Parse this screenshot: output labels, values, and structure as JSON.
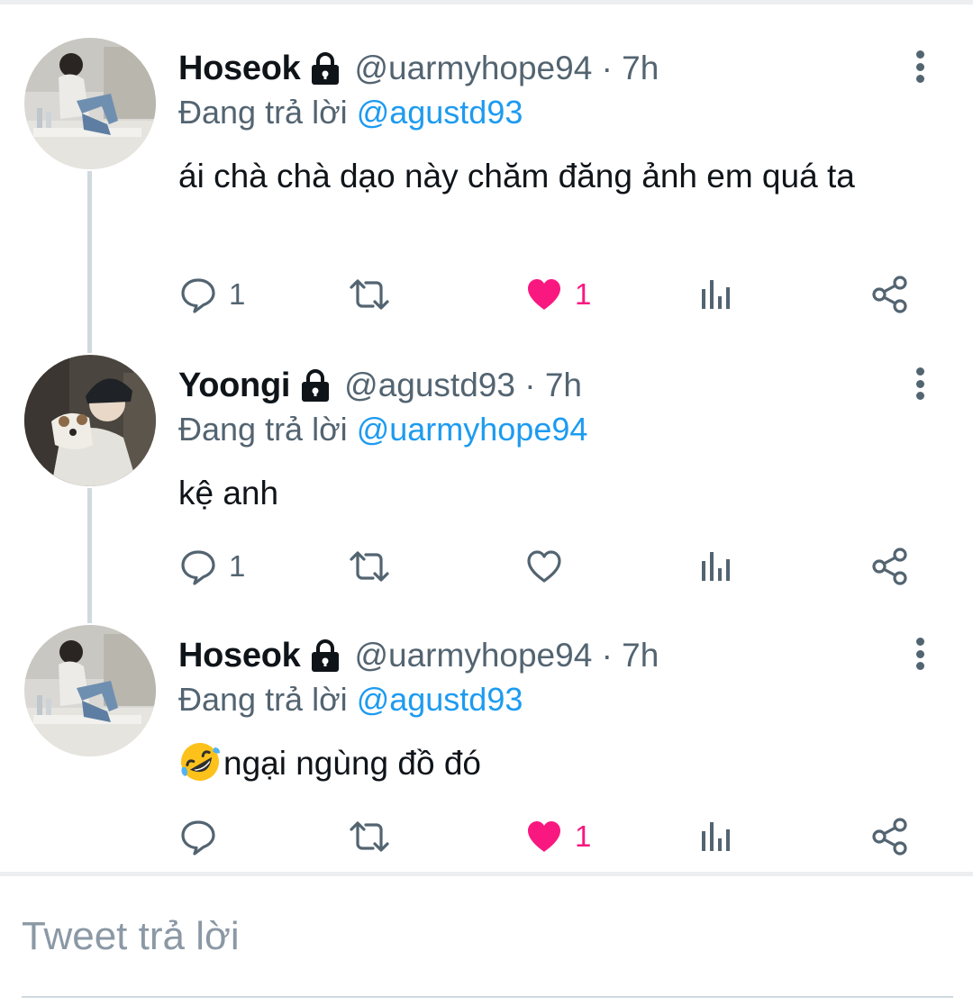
{
  "tweets": [
    {
      "name": "Hoseok",
      "handle": "@uarmyhope94 · 7h",
      "reply_prefix": "Đang trả lời ",
      "reply_to": "@agustd93",
      "text": "ái chà chà dạo này chăm đăng ảnh em quá ta",
      "emoji": "",
      "replies": "1",
      "retweets": "",
      "likes": "1",
      "liked": true,
      "avatar_icon": "avatar-photo-seated-person"
    },
    {
      "name": "Yoongi",
      "handle": "@agustd93 · 7h",
      "reply_prefix": "Đang trả lời ",
      "reply_to": "@uarmyhope94",
      "text": "kệ anh",
      "emoji": "",
      "replies": "1",
      "retweets": "",
      "likes": "",
      "liked": false,
      "avatar_icon": "avatar-photo-person-with-dog"
    },
    {
      "name": "Hoseok",
      "handle": "@uarmyhope94 · 7h",
      "reply_prefix": "Đang trả lời ",
      "reply_to": "@agustd93",
      "text": "ngại ngùng đồ đó",
      "emoji": "rolling-on-floor-laughing",
      "replies": "",
      "retweets": "",
      "likes": "1",
      "liked": true,
      "avatar_icon": "avatar-photo-seated-person"
    }
  ],
  "compose": {
    "placeholder": "Tweet trả lời"
  },
  "colors": {
    "text": "#0f1419",
    "secondary": "#536471",
    "mention": "#1d9bf0",
    "like": "#f91880",
    "thread_line": "#cfd9de"
  }
}
